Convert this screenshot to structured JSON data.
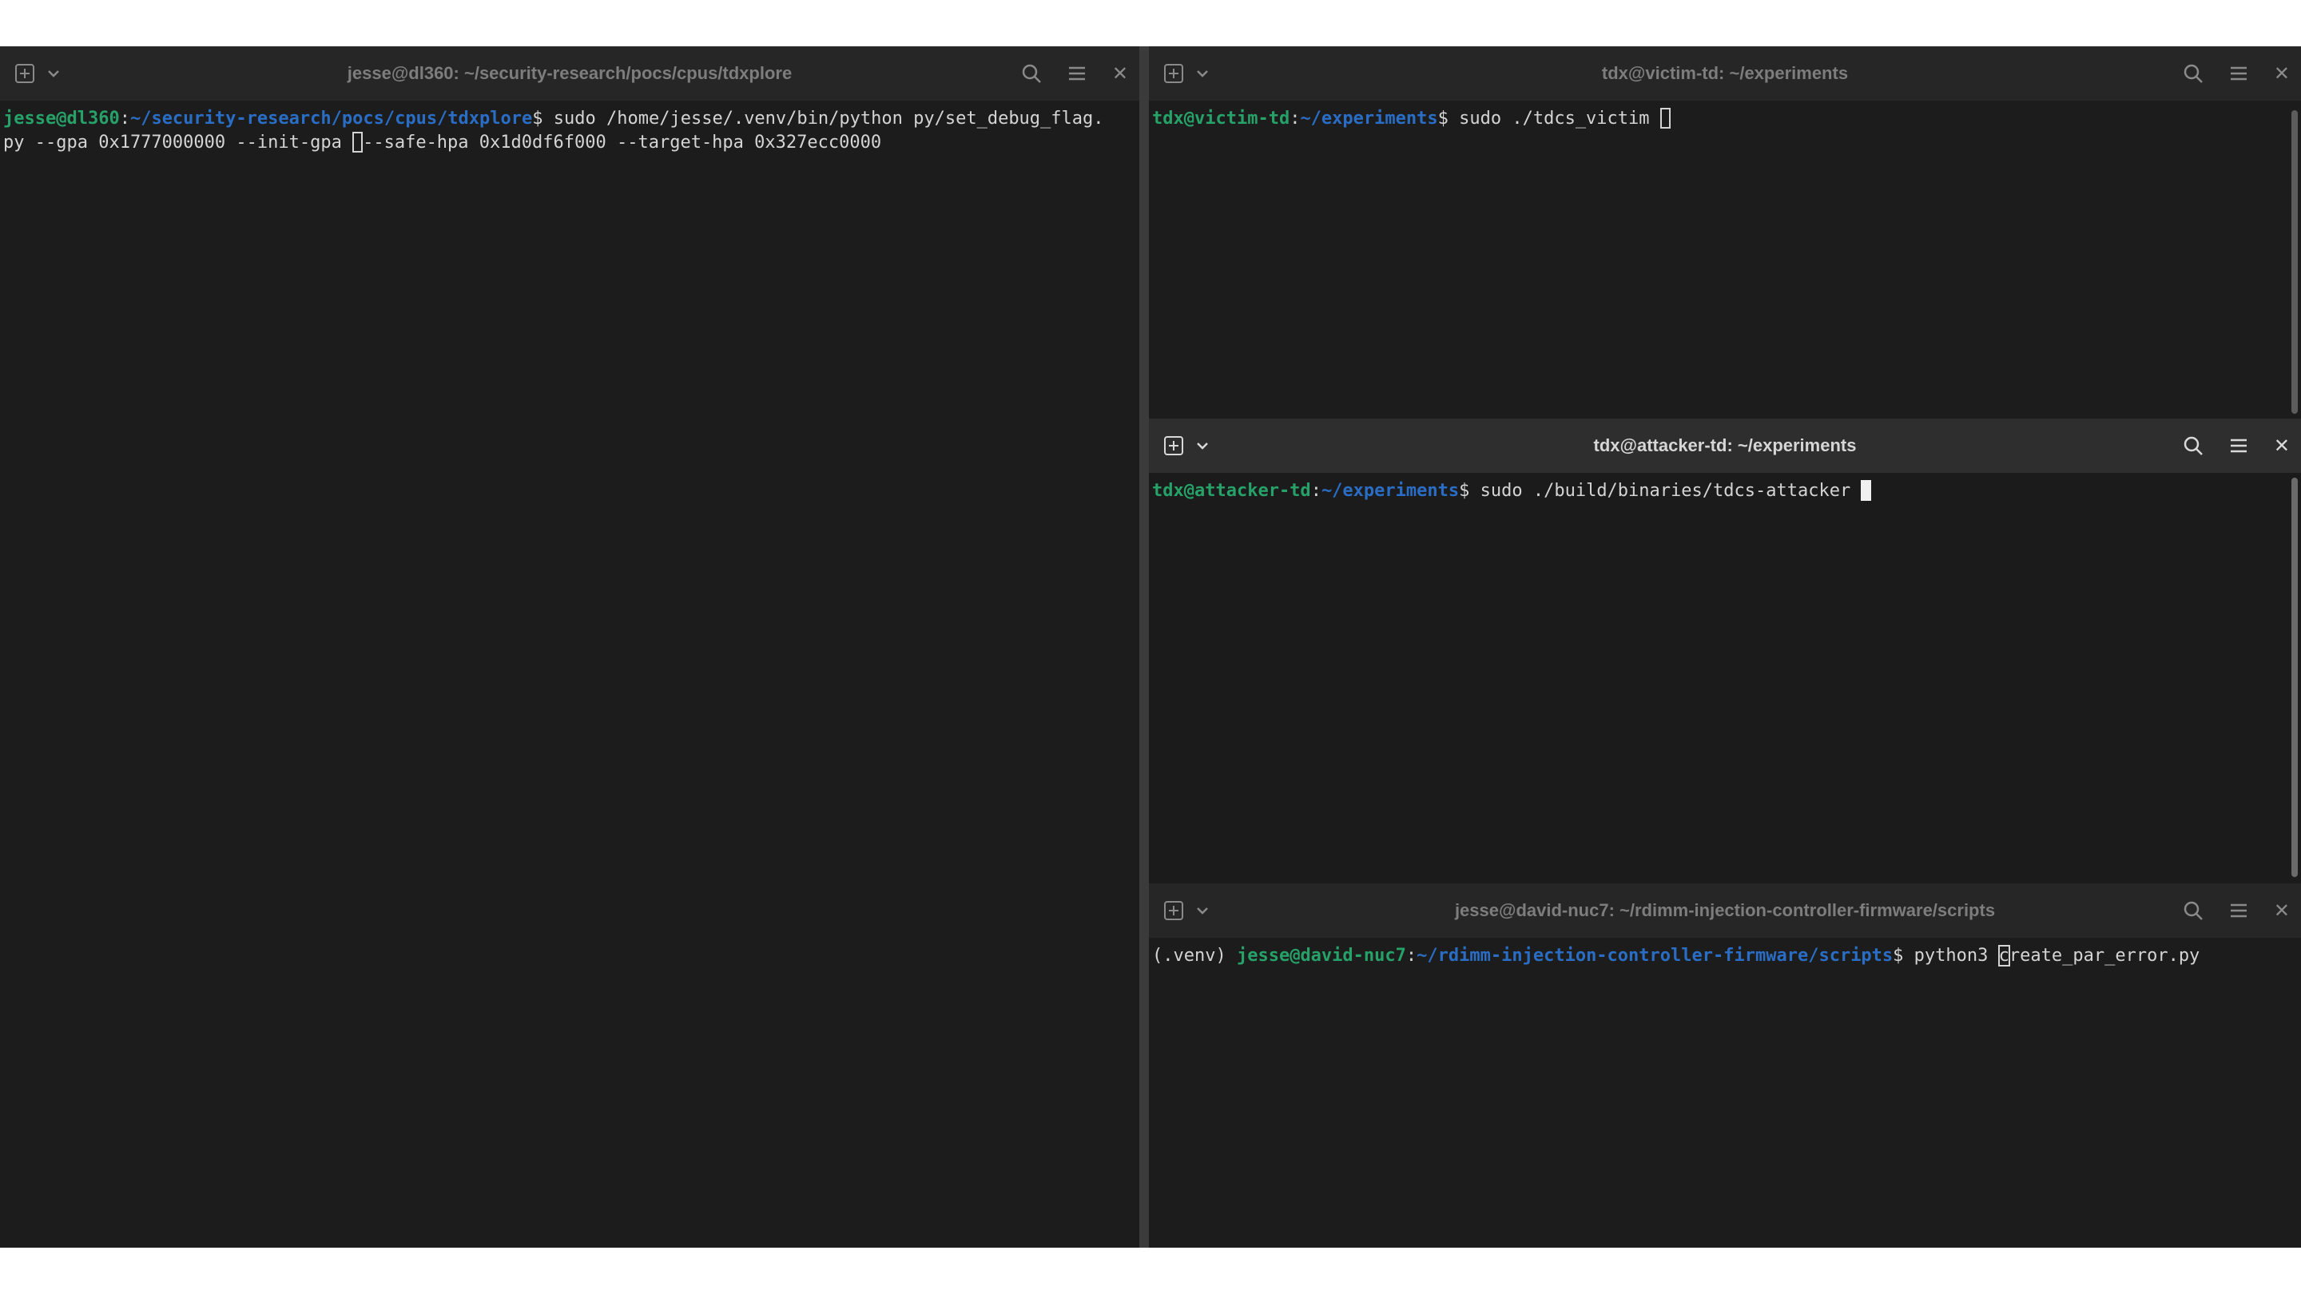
{
  "left_terminal": {
    "title": "jesse@dl360: ~/security-research/pocs/cpus/tdxplore",
    "user": "jesse@dl360",
    "path": "~/security-research/pocs/cpus/tdxplore",
    "line1_cmd": " sudo /home/jesse/.venv/bin/python py/set_debug_flag.",
    "line2_pre": "py --gpa 0x1777000000 --init-gpa ",
    "line2_post": "--safe-hpa 0x1d0df6f000 --target-hpa 0x327ecc0000"
  },
  "victim_terminal": {
    "title": "tdx@victim-td: ~/experiments",
    "user": "tdx@victim-td",
    "path": "~/experiments",
    "cmd": " sudo ./tdcs_victim "
  },
  "attacker_terminal": {
    "title": "tdx@attacker-td: ~/experiments",
    "user": "tdx@attacker-td",
    "path": "~/experiments",
    "cmd": " sudo ./build/binaries/tdcs-attacker "
  },
  "nuc_terminal": {
    "title": "jesse@david-nuc7: ~/rdimm-injection-controller-firmware/scripts",
    "venv": "(.venv) ",
    "user": "jesse@david-nuc7",
    "path": "~/rdimm-injection-controller-firmware/scripts",
    "cmd_pre": " python3 ",
    "cmd_cursor_char": "c",
    "cmd_post": "reate_par_error.py"
  },
  "common": {
    "sep": ":",
    "dollar": "$"
  },
  "colors": {
    "prompt_user": "#26a269",
    "prompt_path": "#2a6dc4",
    "terminal_bg": "#1b1b1b",
    "headerbar_active": "#2e2e2e",
    "headerbar_inactive": "#262626"
  },
  "icons": [
    "new-tab-icon",
    "chevron-down-icon",
    "search-icon",
    "hamburger-menu-icon",
    "close-icon"
  ]
}
